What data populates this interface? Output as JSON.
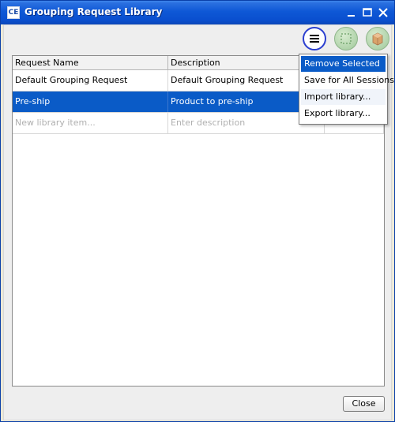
{
  "window": {
    "title": "Grouping Request Library",
    "app_icon_text": "CE"
  },
  "toolbar": {
    "menu_icon": "hamburger-menu-icon",
    "select_icon": "dashed-selection-icon",
    "box_icon": "package-box-icon"
  },
  "table": {
    "columns": [
      "Request Name",
      "Description",
      ""
    ],
    "rows": [
      {
        "name": "Default Grouping Request",
        "description": "Default Grouping Request",
        "extra": ""
      },
      {
        "name": "Pre-ship",
        "description": "Product to pre-ship",
        "extra": ""
      }
    ],
    "new_item_placeholder": "New library item...",
    "new_description_placeholder": "Enter description"
  },
  "menu": {
    "items": [
      "Remove Selected",
      "Save for All Sessions",
      "Import library...",
      "Export library..."
    ]
  },
  "buttons": {
    "close": "Close"
  },
  "colors": {
    "selection": "#0a5bc7",
    "title_bar": "#0e58d6",
    "menu_button_ring": "#2b3fd0"
  }
}
